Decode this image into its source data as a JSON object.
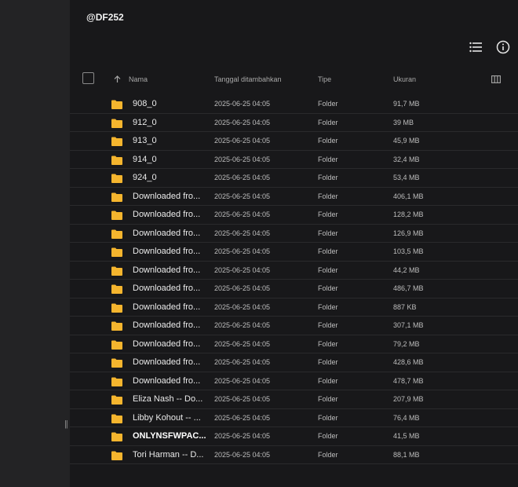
{
  "title": "@DF252",
  "toolbar": {
    "list_icon": "list-view-icon",
    "info_icon": "info-icon"
  },
  "columns": {
    "name": "Nama",
    "date": "Tanggal ditambahkan",
    "type": "Tipe",
    "size": "Ukuran"
  },
  "colors": {
    "folder": "#f5b52e",
    "background": "#18181a",
    "sidebar": "#232325"
  },
  "rows": [
    {
      "name": "908_0",
      "date": "2025-06-25 04:05",
      "type": "Folder",
      "size": "91,7 MB"
    },
    {
      "name": "912_0",
      "date": "2025-06-25 04:05",
      "type": "Folder",
      "size": "39 MB"
    },
    {
      "name": "913_0",
      "date": "2025-06-25 04:05",
      "type": "Folder",
      "size": "45,9 MB"
    },
    {
      "name": "914_0",
      "date": "2025-06-25 04:05",
      "type": "Folder",
      "size": "32,4 MB"
    },
    {
      "name": "924_0",
      "date": "2025-06-25 04:05",
      "type": "Folder",
      "size": "53,4 MB"
    },
    {
      "name": "Downloaded fro...",
      "date": "2025-06-25 04:05",
      "type": "Folder",
      "size": "406,1 MB"
    },
    {
      "name": "Downloaded fro...",
      "date": "2025-06-25 04:05",
      "type": "Folder",
      "size": "128,2 MB"
    },
    {
      "name": "Downloaded fro...",
      "date": "2025-06-25 04:05",
      "type": "Folder",
      "size": "126,9 MB"
    },
    {
      "name": "Downloaded fro...",
      "date": "2025-06-25 04:05",
      "type": "Folder",
      "size": "103,5 MB"
    },
    {
      "name": "Downloaded fro...",
      "date": "2025-06-25 04:05",
      "type": "Folder",
      "size": "44,2 MB"
    },
    {
      "name": "Downloaded fro...",
      "date": "2025-06-25 04:05",
      "type": "Folder",
      "size": "486,7 MB"
    },
    {
      "name": "Downloaded fro...",
      "date": "2025-06-25 04:05",
      "type": "Folder",
      "size": "887 KB"
    },
    {
      "name": "Downloaded fro...",
      "date": "2025-06-25 04:05",
      "type": "Folder",
      "size": "307,1 MB"
    },
    {
      "name": "Downloaded fro...",
      "date": "2025-06-25 04:05",
      "type": "Folder",
      "size": "79,2 MB"
    },
    {
      "name": "Downloaded fro...",
      "date": "2025-06-25 04:05",
      "type": "Folder",
      "size": "428,6 MB"
    },
    {
      "name": "Downloaded fro...",
      "date": "2025-06-25 04:05",
      "type": "Folder",
      "size": "478,7 MB"
    },
    {
      "name": "Eliza Nash -- Do...",
      "date": "2025-06-25 04:05",
      "type": "Folder",
      "size": "207,9 MB"
    },
    {
      "name": "Libby Kohout -- ...",
      "date": "2025-06-25 04:05",
      "type": "Folder",
      "size": "76,4 MB"
    },
    {
      "name": "ONLYNSFWPAC...",
      "date": "2025-06-25 04:05",
      "type": "Folder",
      "size": "41,5 MB",
      "bold": true
    },
    {
      "name": "Tori Harman -- D...",
      "date": "2025-06-25 04:05",
      "type": "Folder",
      "size": "88,1 MB"
    }
  ]
}
